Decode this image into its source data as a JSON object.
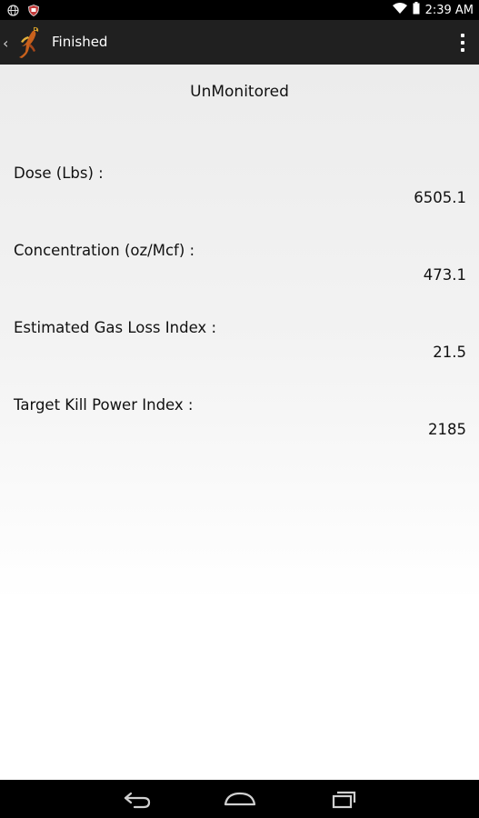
{
  "status_bar": {
    "time": "2:39 AM",
    "icons": [
      "globe-icon",
      "shield-icon",
      "wifi-icon",
      "battery-icon"
    ]
  },
  "action_bar": {
    "title": "Finished",
    "logo": "app-logo-icon",
    "menu_icon": "overflow-menu-icon"
  },
  "content": {
    "mode": "UnMonitored",
    "fields": [
      {
        "label": "Dose (Lbs) :",
        "value": "6505.1"
      },
      {
        "label": "Concentration (oz/Mcf) :",
        "value": "473.1"
      },
      {
        "label": "Estimated Gas Loss Index :",
        "value": "21.5"
      },
      {
        "label": "Target Kill Power Index :",
        "value": "2185"
      }
    ]
  },
  "nav_bar": {
    "buttons": [
      "back-icon",
      "home-icon",
      "recents-icon"
    ]
  }
}
